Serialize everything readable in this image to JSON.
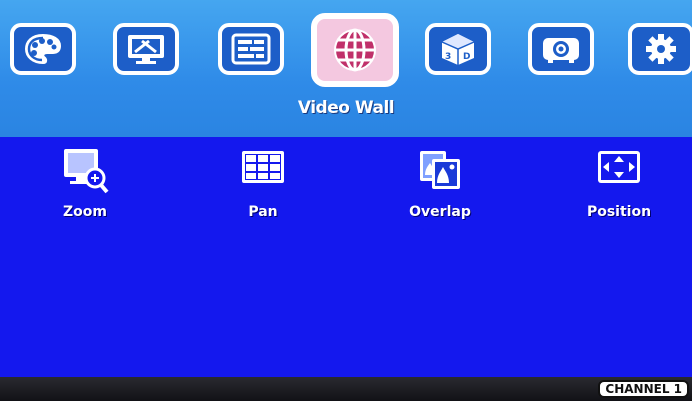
{
  "header": {
    "title": "Video Wall",
    "tabs": [
      {
        "name": "picture",
        "icon": "palette-icon"
      },
      {
        "name": "display-settings",
        "icon": "monitor-tools-icon"
      },
      {
        "name": "input-select",
        "icon": "input-bars-icon"
      },
      {
        "name": "video-wall",
        "icon": "globe-icon",
        "selected": true
      },
      {
        "name": "3d",
        "icon": "3d-cube-icon"
      },
      {
        "name": "output",
        "icon": "projector-icon"
      },
      {
        "name": "system",
        "icon": "gear-icon"
      }
    ]
  },
  "options": [
    {
      "label": "Zoom",
      "icon": "zoom-icon"
    },
    {
      "label": "Pan",
      "icon": "pan-grid-icon"
    },
    {
      "label": "Overlap",
      "icon": "overlap-icon"
    },
    {
      "label": "Position",
      "icon": "position-arrows-icon"
    }
  ],
  "status": {
    "channel": "CHANNEL 1"
  },
  "colors": {
    "header_bg": "#2f8be8",
    "main_bg": "#1418ee",
    "tab_bg": "#1d5ec8",
    "selected_tab_bg": "#f4c8e0",
    "status_bar": "#121216"
  }
}
